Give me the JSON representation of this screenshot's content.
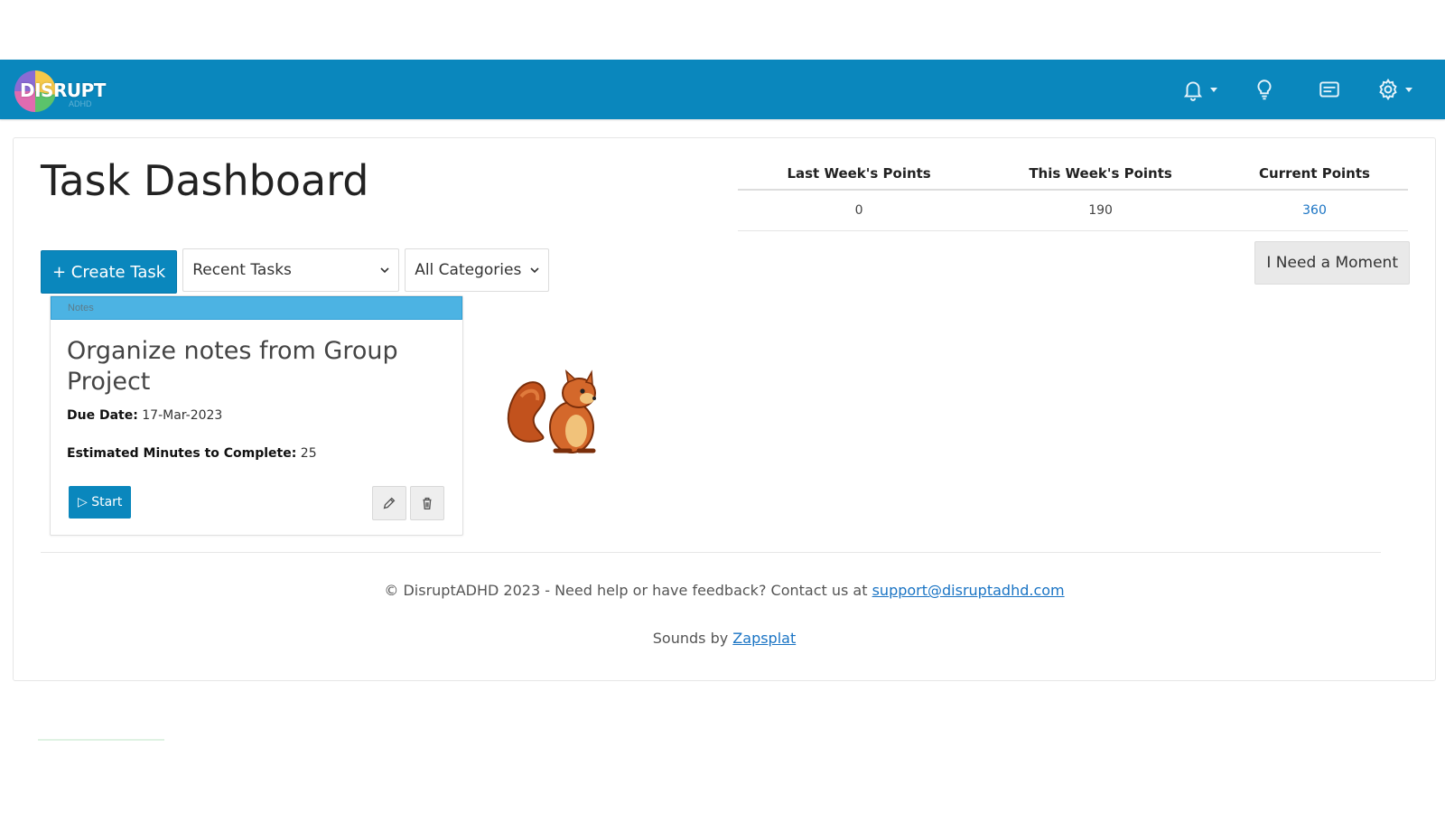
{
  "navbar": {
    "brand": "DISRUPT",
    "brand_sub": "ADHD",
    "background": "#0a87bd",
    "icons": [
      "bell-icon",
      "lightbulb-icon",
      "card-icon",
      "gear-icon"
    ]
  },
  "page": {
    "title": "Task Dashboard"
  },
  "points": {
    "headers": [
      "Last Week's Points",
      "This Week's Points",
      "Current Points"
    ],
    "last_week": "0",
    "this_week": "190",
    "current": "360"
  },
  "toolbar": {
    "create_task": "+ Create Task",
    "filter_recent": "Recent Tasks",
    "filter_category": "All Categories",
    "need_moment": "I Need a Moment"
  },
  "task": {
    "category": "Notes",
    "title": "Organize notes from Group Project",
    "due_label": "Due Date:",
    "due_value": "17-Mar-2023",
    "est_label": "Estimated Minutes to Complete:",
    "est_value": "25",
    "start": "▷ Start"
  },
  "footer": {
    "line1_text": "© DisruptADHD 2023 - Need help or have feedback? Contact us at",
    "email": "support@disruptadhd.com",
    "line2_text": "Sounds by",
    "sounds_link": "Zapsplat"
  }
}
